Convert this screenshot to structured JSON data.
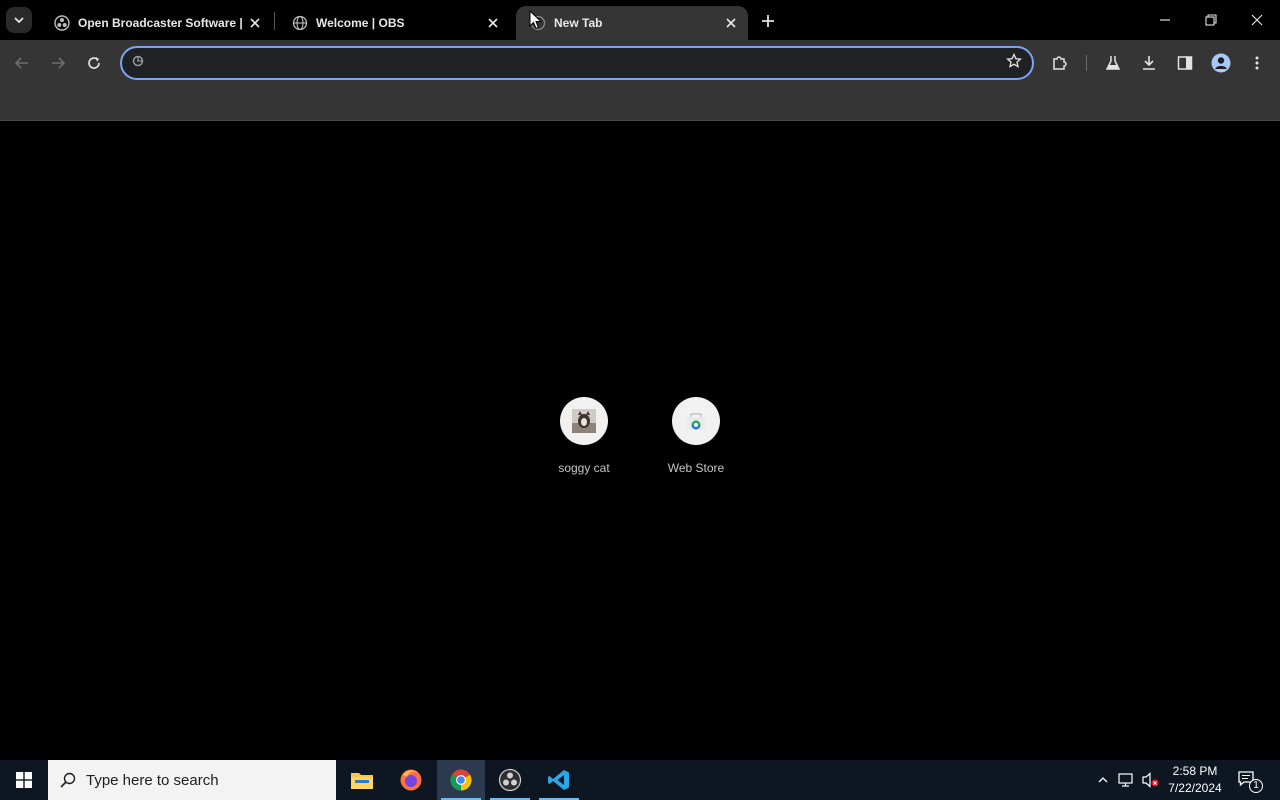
{
  "browser": {
    "tabs": [
      {
        "title": "Open Broadcaster Software | O",
        "active": false
      },
      {
        "title": "Welcome | OBS",
        "active": false
      },
      {
        "title": "New Tab",
        "active": true
      }
    ],
    "omnibox": {
      "value": "",
      "placeholder": ""
    }
  },
  "new_tab": {
    "shortcuts": [
      {
        "label": "soggy cat",
        "icon": "cat-photo-thumbnail"
      },
      {
        "label": "Web Store",
        "icon": "chrome-web-store-icon"
      }
    ]
  },
  "taskbar": {
    "search_placeholder": "Type here to search",
    "apps": [
      "file-explorer",
      "firefox",
      "chrome",
      "obs-studio",
      "vscode"
    ],
    "clock": {
      "time": "2:58 PM",
      "date": "7/22/2024"
    },
    "notification_count": "1"
  },
  "colors": {
    "accent": "#7ca4f4",
    "toolbar": "#353535",
    "taskbar": "#0e1621"
  }
}
